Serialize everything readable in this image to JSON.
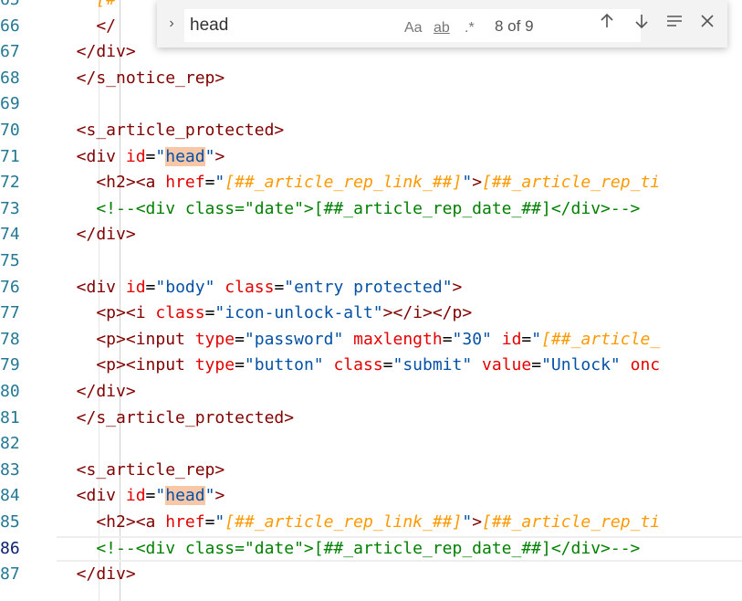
{
  "editor": {
    "active_line": "86",
    "lines": [
      {
        "num": "65",
        "segments": [
          {
            "c": "t-tpl",
            "t": "    [#"
          }
        ]
      },
      {
        "num": "66",
        "segments": [
          {
            "c": "t-tag",
            "t": "    </"
          }
        ]
      },
      {
        "num": "67",
        "segments": [
          {
            "c": "t-tag",
            "t": "  </div>"
          }
        ]
      },
      {
        "num": "68",
        "segments": [
          {
            "c": "t-tag",
            "t": "  </s_notice_rep>"
          }
        ]
      },
      {
        "num": "69",
        "segments": []
      },
      {
        "num": "70",
        "segments": [
          {
            "c": "t-tag",
            "t": "  <s_article_protected>"
          }
        ]
      },
      {
        "num": "71",
        "segments": [
          {
            "c": "t-tag",
            "t": "  <div "
          },
          {
            "c": "t-attr",
            "t": "id"
          },
          {
            "c": "t-txt",
            "t": "="
          },
          {
            "c": "t-str",
            "t": "\""
          },
          {
            "c": "t-str hl",
            "t": "head"
          },
          {
            "c": "t-str",
            "t": "\""
          },
          {
            "c": "t-tag",
            "t": ">"
          }
        ]
      },
      {
        "num": "72",
        "segments": [
          {
            "c": "t-tag",
            "t": "    <h2><a "
          },
          {
            "c": "t-attr",
            "t": "href"
          },
          {
            "c": "t-txt",
            "t": "="
          },
          {
            "c": "t-str",
            "t": "\""
          },
          {
            "c": "t-tpl",
            "t": "[##_article_rep_link_##]"
          },
          {
            "c": "t-str",
            "t": "\""
          },
          {
            "c": "t-tag",
            "t": ">"
          },
          {
            "c": "t-tpl",
            "t": "[##_article_rep_ti"
          }
        ]
      },
      {
        "num": "73",
        "segments": [
          {
            "c": "t-com",
            "t": "    <!--<div class=\"date\">[##_article_rep_date_##]</div>-->"
          }
        ]
      },
      {
        "num": "74",
        "segments": [
          {
            "c": "t-tag",
            "t": "  </div>"
          }
        ]
      },
      {
        "num": "75",
        "segments": []
      },
      {
        "num": "76",
        "segments": [
          {
            "c": "t-tag",
            "t": "  <div "
          },
          {
            "c": "t-attr",
            "t": "id"
          },
          {
            "c": "t-txt",
            "t": "="
          },
          {
            "c": "t-str",
            "t": "\"body\""
          },
          {
            "c": "t-txt",
            "t": " "
          },
          {
            "c": "t-attr",
            "t": "class"
          },
          {
            "c": "t-txt",
            "t": "="
          },
          {
            "c": "t-str",
            "t": "\"entry protected\""
          },
          {
            "c": "t-tag",
            "t": ">"
          }
        ]
      },
      {
        "num": "77",
        "segments": [
          {
            "c": "t-tag",
            "t": "    <p><i "
          },
          {
            "c": "t-attr",
            "t": "class"
          },
          {
            "c": "t-txt",
            "t": "="
          },
          {
            "c": "t-str",
            "t": "\"icon-unlock-alt\""
          },
          {
            "c": "t-tag",
            "t": "></i></p>"
          }
        ]
      },
      {
        "num": "78",
        "segments": [
          {
            "c": "t-tag",
            "t": "    <p><input "
          },
          {
            "c": "t-attr",
            "t": "type"
          },
          {
            "c": "t-txt",
            "t": "="
          },
          {
            "c": "t-str",
            "t": "\"password\""
          },
          {
            "c": "t-txt",
            "t": " "
          },
          {
            "c": "t-attr",
            "t": "maxlength"
          },
          {
            "c": "t-txt",
            "t": "="
          },
          {
            "c": "t-str",
            "t": "\"30\""
          },
          {
            "c": "t-txt",
            "t": " "
          },
          {
            "c": "t-attr",
            "t": "id"
          },
          {
            "c": "t-txt",
            "t": "="
          },
          {
            "c": "t-str",
            "t": "\""
          },
          {
            "c": "t-tpl",
            "t": "[##_article_"
          }
        ]
      },
      {
        "num": "79",
        "segments": [
          {
            "c": "t-tag",
            "t": "    <p><input "
          },
          {
            "c": "t-attr",
            "t": "type"
          },
          {
            "c": "t-txt",
            "t": "="
          },
          {
            "c": "t-str",
            "t": "\"button\""
          },
          {
            "c": "t-txt",
            "t": " "
          },
          {
            "c": "t-attr",
            "t": "class"
          },
          {
            "c": "t-txt",
            "t": "="
          },
          {
            "c": "t-str",
            "t": "\"submit\""
          },
          {
            "c": "t-txt",
            "t": " "
          },
          {
            "c": "t-attr",
            "t": "value"
          },
          {
            "c": "t-txt",
            "t": "="
          },
          {
            "c": "t-str",
            "t": "\"Unlock\""
          },
          {
            "c": "t-txt",
            "t": " "
          },
          {
            "c": "t-attr",
            "t": "onc"
          }
        ]
      },
      {
        "num": "80",
        "segments": [
          {
            "c": "t-tag",
            "t": "  </div>"
          }
        ]
      },
      {
        "num": "81",
        "segments": [
          {
            "c": "t-tag",
            "t": "  </s_article_protected>"
          }
        ]
      },
      {
        "num": "82",
        "segments": []
      },
      {
        "num": "83",
        "segments": [
          {
            "c": "t-tag",
            "t": "  <s_article_rep>"
          }
        ]
      },
      {
        "num": "84",
        "segments": [
          {
            "c": "t-tag",
            "t": "  <div "
          },
          {
            "c": "t-attr",
            "t": "id"
          },
          {
            "c": "t-txt",
            "t": "="
          },
          {
            "c": "t-str",
            "t": "\""
          },
          {
            "c": "t-str hl",
            "t": "head"
          },
          {
            "c": "t-str",
            "t": "\""
          },
          {
            "c": "t-tag",
            "t": ">"
          }
        ]
      },
      {
        "num": "85",
        "segments": [
          {
            "c": "t-tag",
            "t": "    <h2><a "
          },
          {
            "c": "t-attr",
            "t": "href"
          },
          {
            "c": "t-txt",
            "t": "="
          },
          {
            "c": "t-str",
            "t": "\""
          },
          {
            "c": "t-tpl",
            "t": "[##_article_rep_link_##]"
          },
          {
            "c": "t-str",
            "t": "\""
          },
          {
            "c": "t-tag",
            "t": ">"
          },
          {
            "c": "t-tpl",
            "t": "[##_article_rep_ti"
          }
        ]
      },
      {
        "num": "86",
        "segments": [
          {
            "c": "t-com",
            "t": "    <!--<div class=\"date\">[##_article_rep_date_##]</div>-->"
          }
        ]
      },
      {
        "num": "87",
        "segments": [
          {
            "c": "t-tag",
            "t": "  </div>"
          }
        ]
      }
    ]
  },
  "find_widget": {
    "toggle_icon": "chevron-right-icon",
    "query": "head",
    "match_case_label": "Aa",
    "whole_word_label": "ab",
    "regex_label": ".*",
    "match_count": "8 of 9",
    "prev_icon": "arrow-up-icon",
    "next_icon": "arrow-down-icon",
    "selection_icon": "find-in-selection-icon",
    "close_icon": "close-icon"
  }
}
